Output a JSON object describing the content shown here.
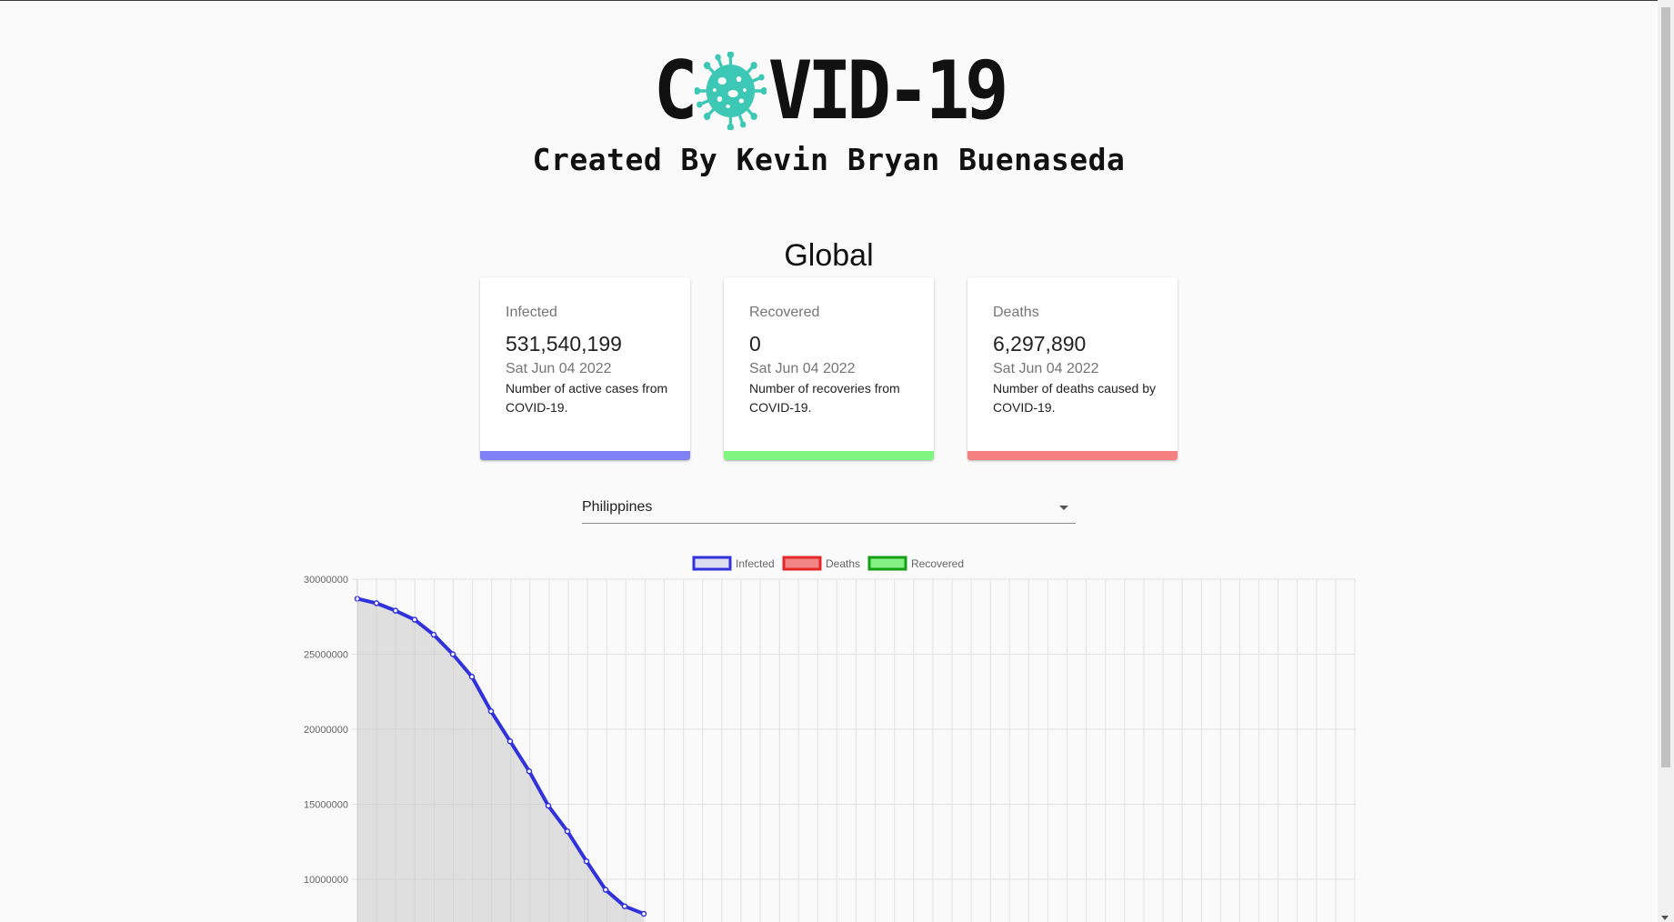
{
  "header": {
    "logo_left": "C",
    "logo_right": "VID-19",
    "logo_icon": "coronavirus-icon",
    "subtitle": "Created By Kevin Bryan Buenaseda"
  },
  "global": {
    "title": "Global",
    "cards": [
      {
        "label": "Infected",
        "value": "531,540,199",
        "date": "Sat Jun 04 2022",
        "description": "Number of active cases from COVID-19.",
        "color": "#8080f5"
      },
      {
        "label": "Recovered",
        "value": "0",
        "date": "Sat Jun 04 2022",
        "description": "Number of recoveries from COVID-19.",
        "color": "#80f580"
      },
      {
        "label": "Deaths",
        "value": "6,297,890",
        "date": "Sat Jun 04 2022",
        "description": "Number of deaths caused by COVID-19.",
        "color": "#f58080"
      }
    ]
  },
  "country_select": {
    "value": "Philippines"
  },
  "chart_data": {
    "type": "area",
    "title": "",
    "xlabel": "",
    "ylabel": "",
    "ylim": [
      10000000,
      30000000
    ],
    "yticks": [
      "30000000",
      "25000000",
      "20000000",
      "15000000",
      "10000000"
    ],
    "grid": true,
    "legend_position": "top",
    "series": [
      {
        "name": "Infected",
        "color": "#3232dc",
        "fill": "rgba(200,200,200,0.55)",
        "values": [
          28700000,
          28400000,
          27900000,
          27300000,
          26300000,
          25000000,
          23500000,
          21200000,
          19200000,
          17200000,
          14900000,
          13200000,
          11200000,
          9300000,
          8200000,
          7700000
        ]
      },
      {
        "name": "Deaths",
        "color": "#e62828",
        "values": []
      },
      {
        "name": "Recovered",
        "color": "#14a014",
        "values": []
      }
    ]
  }
}
